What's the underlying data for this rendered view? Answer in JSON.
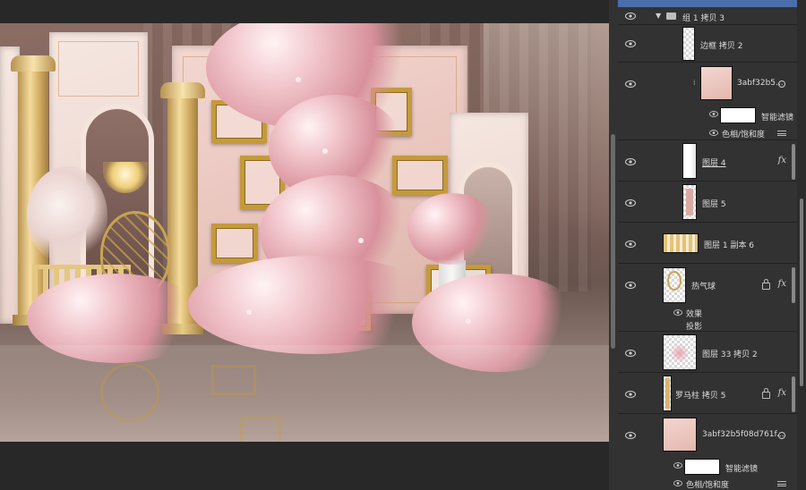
{
  "layers_panel": {
    "group": {
      "name": "组 1 拷贝 3",
      "icon": "folder-icon",
      "expanded": true
    },
    "layers": [
      {
        "id": "border-copy-2",
        "name": "边框 拷贝 2",
        "visible": true,
        "thumb": "transparent-tall"
      },
      {
        "id": "smart-object-1",
        "name": "3abf32b5...",
        "visible": true,
        "smart_object": true,
        "thumb": "pink"
      },
      {
        "id": "layer-4",
        "name": "图层 4",
        "visible": true,
        "fx": "fx",
        "thumb": "white-transparent"
      },
      {
        "id": "layer-5",
        "name": "图层 5",
        "visible": true,
        "thumb": "pink-transparent"
      },
      {
        "id": "layer-1-copy-6",
        "name": "图层 1 副本 6",
        "visible": true,
        "thumb": "gold-railing"
      },
      {
        "id": "hot-air-balloon",
        "name": "热气球",
        "visible": true,
        "locked": true,
        "fx": "fx",
        "thumb": "balloon"
      },
      {
        "id": "layer-33-copy-2",
        "name": "图层 33 拷贝 2",
        "visible": true,
        "thumb": "flowers"
      },
      {
        "id": "roman-column-copy-5",
        "name": "罗马柱 拷贝 5",
        "visible": true,
        "locked": true,
        "fx": "fx",
        "thumb": "column"
      },
      {
        "id": "smart-object-2",
        "name": "3abf32b5f08d761f...",
        "visible": true,
        "smart_object": true,
        "thumb": "pink"
      }
    ],
    "smart_filters_1": {
      "label": "智能滤镜",
      "adjustment": "色相/饱和度"
    },
    "effects": {
      "label": "效果",
      "drop_shadow": "投影"
    },
    "smart_filters_2": {
      "label": "智能滤镜",
      "adjustment": "色相/饱和度"
    }
  },
  "colors": {
    "panel_bg": "#323232",
    "canvas_bg": "#282828",
    "gold": "#c59a3c",
    "pink_wall": "#e9c5bd",
    "selection": "#4b6ea8"
  }
}
